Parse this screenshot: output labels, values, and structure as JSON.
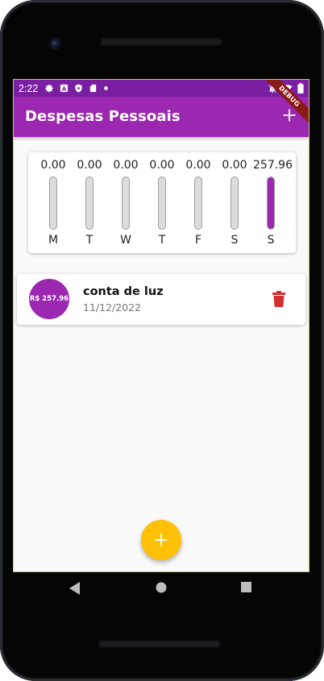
{
  "status_bar": {
    "time": "2:22",
    "left_icons": [
      "gear-icon",
      "a-icon",
      "shield-icon",
      "sd-card-icon",
      "dot-icon"
    ],
    "right_icons": [
      "notifications-off-icon",
      "wifi-icon",
      "battery-icon"
    ]
  },
  "debug_banner": "DEBUG",
  "app_bar": {
    "title": "Despesas Pessoais",
    "add_icon": "add-icon"
  },
  "colors": {
    "primary": "#9c27b0",
    "primary_dark": "#7b1fa2",
    "accent": "#ffc107",
    "delete": "#d32f2f"
  },
  "chart_data": {
    "type": "bar",
    "categories": [
      "M",
      "T",
      "W",
      "T",
      "F",
      "S",
      "S"
    ],
    "value_labels": [
      "0.00",
      "0.00",
      "0.00",
      "0.00",
      "0.00",
      "0.00",
      "257.96"
    ],
    "values": [
      0,
      0,
      0,
      0,
      0,
      0,
      257.96
    ],
    "fill_fraction": [
      0,
      0,
      0,
      0,
      0,
      0,
      1.0
    ]
  },
  "transactions": [
    {
      "amount_label": "R$ 257.96",
      "title": "conta de luz",
      "date": "11/12/2022",
      "delete_icon": "trash-icon"
    }
  ],
  "fab": {
    "icon": "add-icon"
  },
  "nav": {
    "icons": [
      "back-icon",
      "home-icon",
      "recents-icon"
    ]
  }
}
